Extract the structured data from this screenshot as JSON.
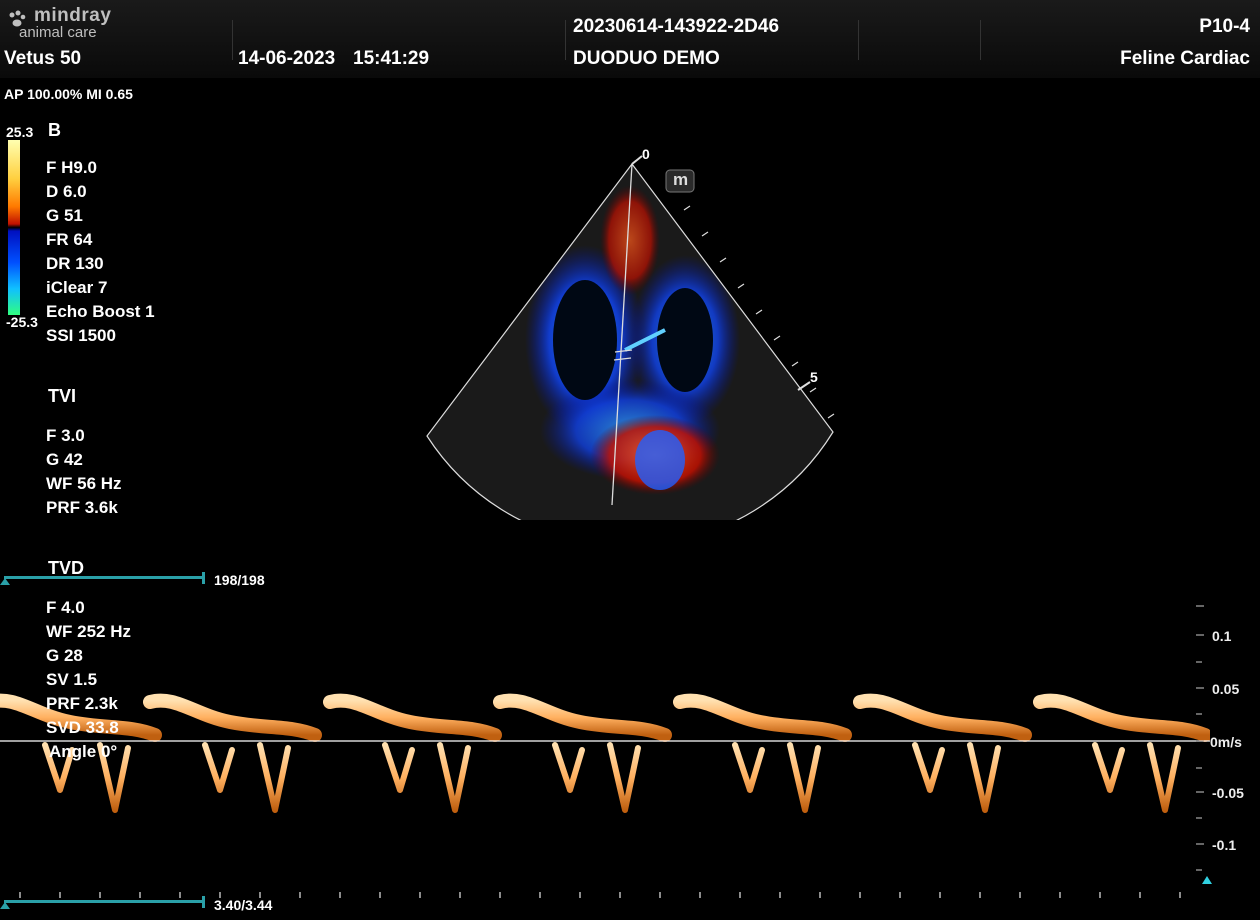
{
  "header": {
    "brand": "mindray",
    "brand_sub": "animal care",
    "model": "Vetus 50",
    "date": "14-06-2023",
    "time": "15:41:29",
    "study_id": "20230614-143922-2D46",
    "patient": "DUODUO DEMO",
    "probe": "P10-4",
    "preset": "Feline Cardiac"
  },
  "status": {
    "ap_mi": "AP 100.00%  MI 0.65"
  },
  "colorbar": {
    "max": "25.3",
    "min": "-25.3"
  },
  "bmode": {
    "title": "B",
    "params": [
      "F H9.0",
      "D 6.0",
      "G 51",
      "FR 64",
      "DR 130",
      "iClear 7",
      "Echo Boost 1",
      "SSI 1500"
    ]
  },
  "tvi": {
    "title": "TVI",
    "params": [
      "F 3.0",
      "G 42",
      "WF 56 Hz",
      "PRF 3.6k"
    ]
  },
  "tvd": {
    "title": "TVD",
    "params": [
      "F 4.0",
      "WF 252 Hz",
      "G 28",
      "SV 1.5",
      "PRF 2.3k",
      "SVD 33.8",
      "Angle    0°"
    ]
  },
  "sector": {
    "depth_top": "0",
    "depth_mark": "5",
    "m_button": "m"
  },
  "cine": {
    "frame_counter": "198/198",
    "time_counter": "3.40/3.44"
  },
  "doppler_scale": {
    "labels": [
      "0.1",
      "0.05",
      "0m/s",
      "-0.05",
      "-0.1"
    ]
  }
}
